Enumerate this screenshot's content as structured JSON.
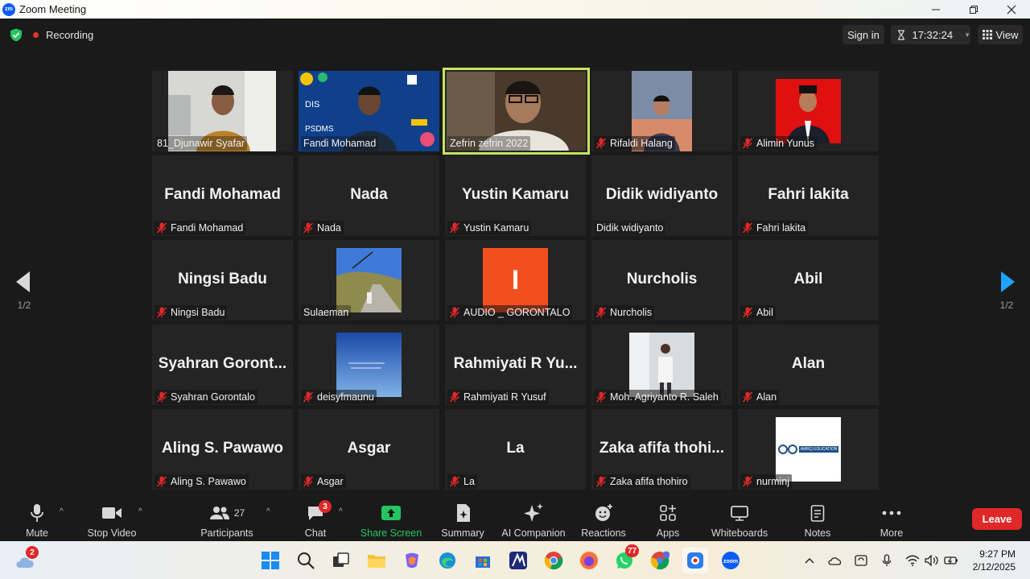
{
  "window": {
    "title": "Zoom Meeting",
    "logo_text": "zm"
  },
  "topbar": {
    "recording": "Recording",
    "sign_in": "Sign in",
    "timer": "17:32:24",
    "view": "View"
  },
  "pagination": {
    "left": "1/2",
    "right": "1/2"
  },
  "tiles": [
    {
      "id": "t1",
      "name": "81_Djunawir Syafar",
      "display": "",
      "muted": false,
      "video": true
    },
    {
      "id": "t2",
      "name": "Fandi Mohamad",
      "display": "",
      "muted": false,
      "video": true
    },
    {
      "id": "t3",
      "name": "Zefrin zefrin 2022",
      "display": "",
      "muted": false,
      "video": true,
      "active": true
    },
    {
      "id": "t4",
      "name": "Rifaldi Halang",
      "display": "",
      "muted": true,
      "video": true
    },
    {
      "id": "t5",
      "name": "Alimin Yunus",
      "display": "",
      "muted": true,
      "video": true
    },
    {
      "id": "t6",
      "name": "Fandi Mohamad",
      "display": "Fandi Mohamad",
      "muted": true
    },
    {
      "id": "t7",
      "name": "Nada",
      "display": "Nada",
      "muted": true
    },
    {
      "id": "t8",
      "name": "Yustin Kamaru",
      "display": "Yustin Kamaru",
      "muted": true
    },
    {
      "id": "t9",
      "name": "Didik widiyanto",
      "display": "Didik widiyanto",
      "muted": false
    },
    {
      "id": "t10",
      "name": "Fahri lakita",
      "display": "Fahri lakita",
      "muted": true
    },
    {
      "id": "t11",
      "name": "Ningsi Badu",
      "display": "Ningsi Badu",
      "muted": true
    },
    {
      "id": "t12",
      "name": "Sulaeman",
      "display": "",
      "muted": false,
      "video": true
    },
    {
      "id": "t13",
      "name": "AUDIO _ GORONTALO",
      "display": "",
      "muted": true,
      "video": true,
      "pic_letter": "I"
    },
    {
      "id": "t14",
      "name": "Nurcholis",
      "display": "Nurcholis",
      "muted": true
    },
    {
      "id": "t15",
      "name": "Abil",
      "display": "Abil",
      "muted": true
    },
    {
      "id": "t16",
      "name": "Syahran Gorontalo",
      "display": "Syahran  Goront...",
      "muted": true
    },
    {
      "id": "t17",
      "name": "deisyfmaunu",
      "display": "",
      "muted": true,
      "video": true
    },
    {
      "id": "t18",
      "name": "Rahmiyati R Yusuf",
      "display": "Rahmiyati  R Yu...",
      "muted": true
    },
    {
      "id": "t19",
      "name": "Moh. Agriyanto R. Saleh",
      "display": "",
      "muted": true,
      "video": true
    },
    {
      "id": "t20",
      "name": "Alan",
      "display": "Alan",
      "muted": true
    },
    {
      "id": "t21",
      "name": "Aling S. Pawawo",
      "display": "Aling S. Pawawo",
      "muted": true
    },
    {
      "id": "t22",
      "name": "Asgar",
      "display": "Asgar",
      "muted": true
    },
    {
      "id": "t23",
      "name": "La",
      "display": "La",
      "muted": true
    },
    {
      "id": "t24",
      "name": "Zaka afifa thohiro",
      "display": "Zaka afifa thohi...",
      "muted": true
    },
    {
      "id": "t25",
      "name": "nurminj",
      "display": "",
      "muted": true,
      "video": true,
      "logo_text": "AMRQ EDUCATION"
    }
  ],
  "toolbar": {
    "mute": "Mute",
    "stop_video": "Stop Video",
    "participants": "Participants",
    "participants_count": "27",
    "chat": "Chat",
    "chat_badge": "3",
    "share_screen": "Share Screen",
    "summary": "Summary",
    "ai_companion": "AI Companion",
    "reactions": "Reactions",
    "apps": "Apps",
    "whiteboards": "Whiteboards",
    "notes": "Notes",
    "more": "More",
    "leave": "Leave"
  },
  "taskbar": {
    "weather_badge": "2",
    "whatsapp_badge": "77",
    "time": "9:27 PM",
    "date": "2/12/2025"
  },
  "colors": {
    "active_speaker": "#c7e35f",
    "leave": "#e02828",
    "share_green": "#23c55e",
    "recording": "#e5322d"
  }
}
